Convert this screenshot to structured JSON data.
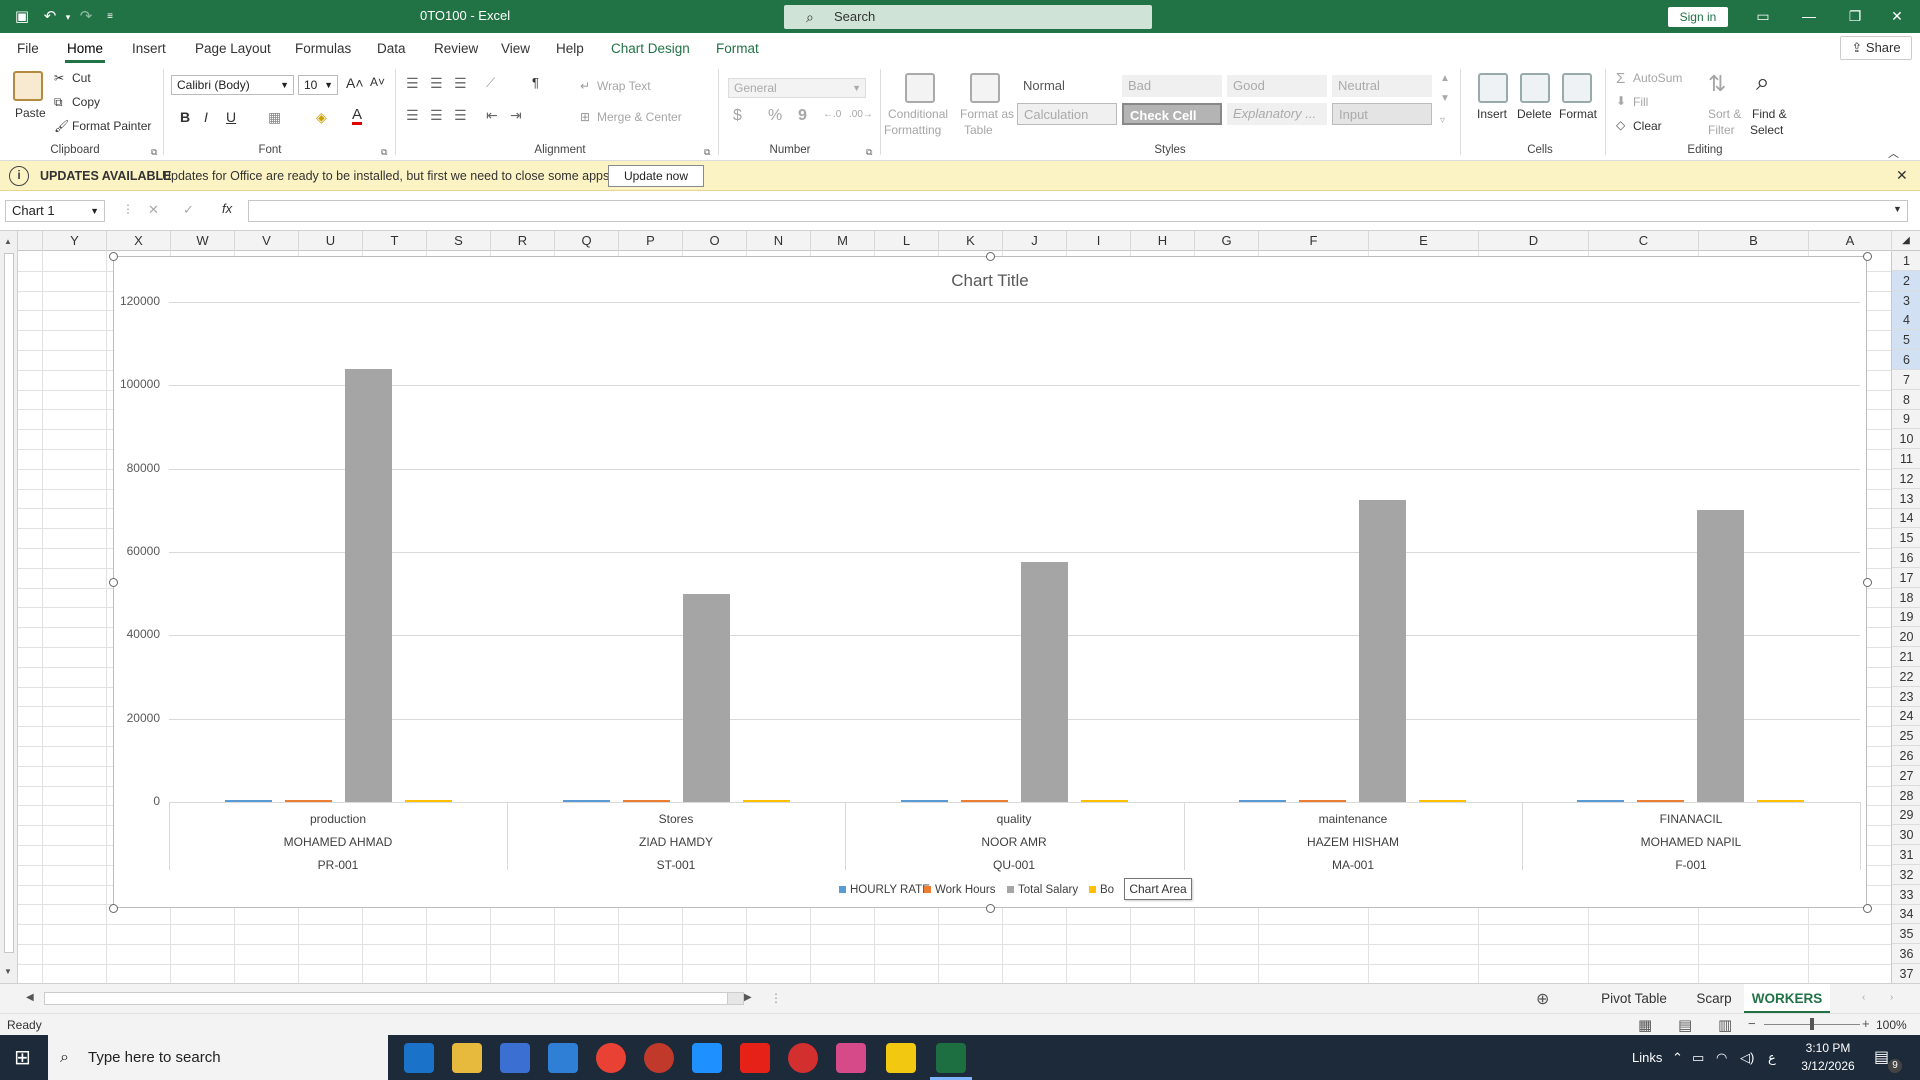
{
  "titlebar": {
    "doc_title": "0TO100  -  Excel",
    "search_placeholder": "Search",
    "signin": "Sign in"
  },
  "ribbon_tabs": [
    "File",
    "Home",
    "Insert",
    "Page Layout",
    "Formulas",
    "Data",
    "Review",
    "View",
    "Help",
    "Chart Design",
    "Format"
  ],
  "share": "Share",
  "clipboard": {
    "paste": "Paste",
    "cut": "Cut",
    "copy": "Copy",
    "format_painter": "Format Painter",
    "label": "Clipboard"
  },
  "font": {
    "name": "Calibri (Body)",
    "size": "10",
    "label": "Font",
    "bold": "B",
    "italic": "I",
    "underline": "U"
  },
  "alignment": {
    "wrap": "Wrap Text",
    "merge": "Merge & Center",
    "label": "Alignment"
  },
  "number": {
    "format": "General",
    "label": "Number",
    "currency": "$",
    "percent": "%",
    "comma": "9"
  },
  "styles": {
    "conditional": "Conditional",
    "conditional2": "Formatting",
    "format_table": "Format as",
    "format_table2": "Table",
    "cells": [
      [
        "Normal",
        "Bad",
        "Good",
        "Neutral"
      ],
      [
        "Calculation",
        "Check Cell",
        "Explanatory ...",
        "Input"
      ]
    ],
    "label": "Styles"
  },
  "cells_group": {
    "insert": "Insert",
    "delete": "Delete",
    "format": "Format",
    "label": "Cells"
  },
  "editing": {
    "autosum": "AutoSum",
    "fill": "Fill",
    "clear": "Clear",
    "sort": "Sort &",
    "sort2": "Filter",
    "find": "Find &",
    "find2": "Select",
    "label": "Editing"
  },
  "update_bar": {
    "title": "UPDATES AVAILABLE",
    "message": "Updates for Office are ready to be installed, but first we need to close some apps.",
    "button": "Update now"
  },
  "formula_bar": {
    "name_box": "Chart 1",
    "fx": "fx"
  },
  "columns": [
    "Y",
    "X",
    "W",
    "V",
    "U",
    "T",
    "S",
    "R",
    "Q",
    "P",
    "O",
    "N",
    "M",
    "L",
    "K",
    "J",
    "I",
    "H",
    "G",
    "F",
    "E",
    "D",
    "C",
    "B",
    "A"
  ],
  "rows": [
    "1",
    "2",
    "3",
    "4",
    "5",
    "6",
    "7",
    "8",
    "9",
    "10",
    "11",
    "12",
    "13",
    "14",
    "15",
    "16",
    "17",
    "18",
    "19",
    "20",
    "21",
    "22",
    "23",
    "24",
    "25",
    "26",
    "27",
    "28",
    "29",
    "30",
    "31",
    "32",
    "33",
    "34",
    "35",
    "36",
    "37"
  ],
  "chart_data": {
    "type": "bar",
    "title": "Chart Title",
    "categories": [
      [
        "production",
        "MOHAMED AHMAD",
        "PR-001"
      ],
      [
        "Stores",
        "ZIAD HAMDY",
        "ST-001"
      ],
      [
        "quality",
        "NOOR AMR",
        "QU-001"
      ],
      [
        "maintenance",
        "HAZEM HISHAM",
        "MA-001"
      ],
      [
        "FINANACIL",
        "MOHAMED NAPIL",
        "F-001"
      ]
    ],
    "series": [
      {
        "name": "HOURLY RATE",
        "color": "#5b9bd5",
        "values": [
          350,
          300,
          300,
          300,
          350
        ]
      },
      {
        "name": "Work Hours",
        "color": "#ed7d31",
        "values": [
          300,
          300,
          300,
          300,
          300
        ]
      },
      {
        "name": "Total Salary",
        "color": "#a5a5a5",
        "values": [
          104000,
          50000,
          57500,
          72500,
          70000
        ]
      },
      {
        "name": "Bo",
        "color": "#ffc000",
        "values": [
          300,
          300,
          300,
          300,
          300
        ]
      }
    ],
    "ylim": [
      0,
      120000
    ],
    "yticks": [
      "0",
      "20000",
      "40000",
      "60000",
      "80000",
      "100000",
      "120000"
    ],
    "grid": true,
    "legend": "bottom",
    "tooltip": "Chart Area"
  },
  "sheet_tabs": [
    "Pivot Table",
    "Scarp",
    "WORKERS"
  ],
  "status": {
    "text": "Ready",
    "zoom": "100%"
  },
  "taskbar": {
    "search": "Type here to search",
    "links": "Links",
    "lang": "ع",
    "time": "3:10 PM",
    "date": "3/12/2026",
    "notif": "9"
  }
}
